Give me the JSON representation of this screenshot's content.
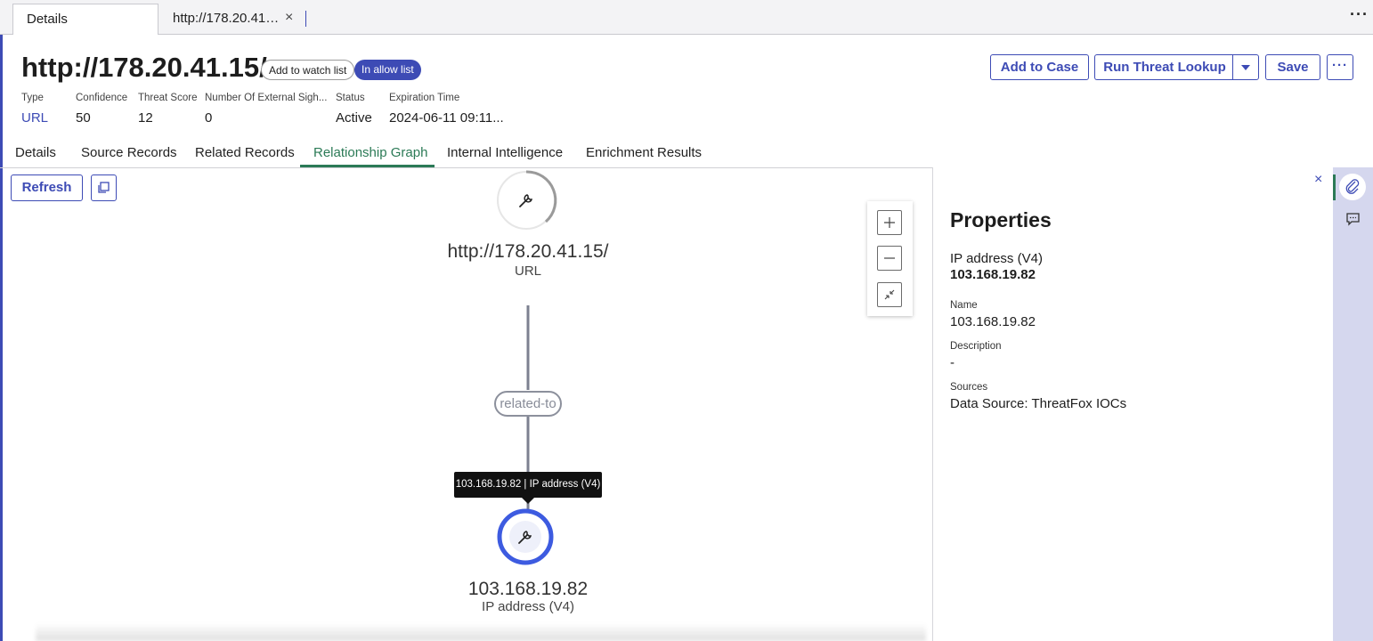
{
  "tabs": {
    "details": "Details",
    "url_tab": "http://178.20.41…",
    "close_glyph": "×",
    "more_glyph": "···"
  },
  "header": {
    "title": "http://178.20.41.15/",
    "watch_button": "Add to watch list",
    "allow_badge": "In allow list",
    "buttons": {
      "add_to_case": "Add to Case",
      "run_threat_lookup": "Run Threat Lookup",
      "save": "Save",
      "more": "···"
    },
    "meta": [
      {
        "label": "Type",
        "value": "URL"
      },
      {
        "label": "Confidence",
        "value": "50"
      },
      {
        "label": "Threat Score",
        "value": "12"
      },
      {
        "label": "Number Of External Sigh...",
        "value": "0"
      },
      {
        "label": "Status",
        "value": "Active"
      },
      {
        "label": "Expiration Time",
        "value": "2024-06-11 09:11..."
      }
    ]
  },
  "nav": {
    "tabs": [
      "Details",
      "Source Records",
      "Related Records",
      "Relationship Graph",
      "Internal Intelligence",
      "Enrichment Results"
    ],
    "active": "Relationship Graph"
  },
  "graph": {
    "refresh_label": "Refresh",
    "source_node": {
      "title": "http://178.20.41.15/",
      "type": "URL"
    },
    "edge_label": "related-to",
    "target_node": {
      "title": "103.168.19.82",
      "type": "IP address (V4)"
    },
    "tooltip": "103.168.19.82 | IP address (V4)",
    "icons": [
      "wrench-icon",
      "plus-icon",
      "minus-icon",
      "fit-icon",
      "copy-icon"
    ]
  },
  "properties": {
    "title": "Properties",
    "close_glyph": "×",
    "type_label": "IP address (V4)",
    "type_value": "103.168.19.82",
    "name_label": "Name",
    "name_value": "103.168.19.82",
    "description_label": "Description",
    "description_value": "-",
    "sources_label": "Sources",
    "sources_value": "Data Source: ThreatFox IOCs"
  },
  "colors": {
    "accent": "#3d4bb5",
    "active_tab": "#2b7a56",
    "rail": "#d5d7ee"
  }
}
